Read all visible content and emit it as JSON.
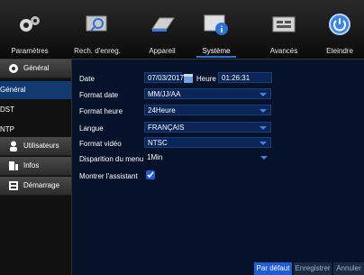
{
  "topbar": {
    "tabs": [
      {
        "label": "Paramètres",
        "icon": "gears-icon"
      },
      {
        "label": "Rech. d'enreg.",
        "icon": "search-monitor-icon"
      },
      {
        "label": "Appareil",
        "icon": "hard-drive-icon"
      },
      {
        "label": "Système",
        "icon": "system-info-icon",
        "active": true
      },
      {
        "label": "Avancés",
        "icon": "advanced-icon"
      },
      {
        "label": "Eteindre",
        "icon": "power-icon"
      }
    ]
  },
  "sidebar": {
    "sections": [
      {
        "label": "Général",
        "icon": "gear-icon"
      },
      {
        "label": "Utilisateurs",
        "icon": "user-icon"
      },
      {
        "label": "Infos",
        "icon": "info-icon"
      },
      {
        "label": "Démarrage",
        "icon": "startup-icon"
      }
    ],
    "items": [
      {
        "label": "Général",
        "active": true
      },
      {
        "label": "DST"
      },
      {
        "label": "NTP"
      }
    ]
  },
  "form": {
    "date_label": "Date",
    "date_value": "07/03/2017",
    "time_label": "Heure",
    "time_value": "01:26:31",
    "date_format_label": "Format date",
    "date_format_value": "MM/JJ/AA",
    "time_format_label": "Format heure",
    "time_format_value": "24Heure",
    "language_label": "Langue",
    "language_value": "FRANÇAIS",
    "video_format_label": "Format vidéo",
    "video_format_value": "NTSC",
    "menu_timeout_label": "Disparition du menu",
    "menu_timeout_value": "1Min",
    "show_wizard_label": "Montrer l'assistant",
    "show_wizard_checked": true
  },
  "buttons": {
    "default": "Par défaut",
    "save": "Enregistrer",
    "cancel": "Annuler"
  },
  "colors": {
    "accent": "#1e5bd6",
    "content_bg": "#05122a",
    "field_bg": "#0a2556"
  }
}
